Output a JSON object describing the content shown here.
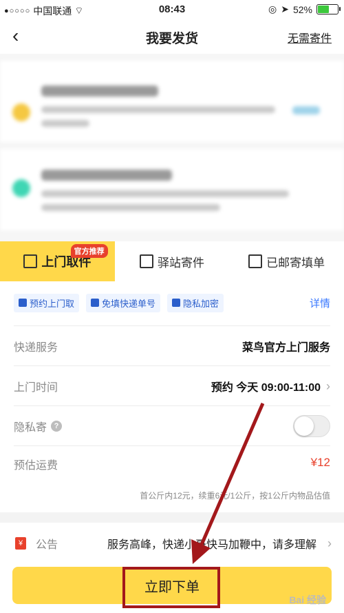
{
  "status_bar": {
    "carrier": "中国联通",
    "time": "08:43",
    "battery_text": "52%",
    "battery_level": 0.52
  },
  "nav": {
    "title": "我要发货",
    "right_link": "无需寄件"
  },
  "tabs": [
    {
      "label": "上门取件",
      "badge": "官方推荐",
      "active": true
    },
    {
      "label": "驿站寄件",
      "active": false
    },
    {
      "label": "已邮寄填单",
      "active": false
    }
  ],
  "features": {
    "items": [
      "预约上门取",
      "免填快递单号",
      "隐私加密"
    ],
    "details": "详情"
  },
  "rows": {
    "service": {
      "label": "快递服务",
      "value": "菜鸟官方上门服务"
    },
    "pickup_time": {
      "label": "上门时间",
      "value": "预约 今天 09:00-11:00"
    },
    "private": {
      "label": "隐私寄",
      "help": "?"
    },
    "fee": {
      "label": "预估运费",
      "value": "¥12",
      "note": "首公斤内12元，续重6元/1公斤，按1公斤内物品估值"
    }
  },
  "notice": {
    "icon_text": "¥",
    "label": "公告",
    "text": "服务高峰，快递小哥快马加鞭中，请多理解"
  },
  "submit": {
    "label": "立即下单"
  },
  "watermark": "Bai 经验",
  "colors": {
    "accent": "#ffd84a",
    "red": "#e8412c",
    "link": "#3a78ff",
    "annotation": "#a3181b"
  }
}
